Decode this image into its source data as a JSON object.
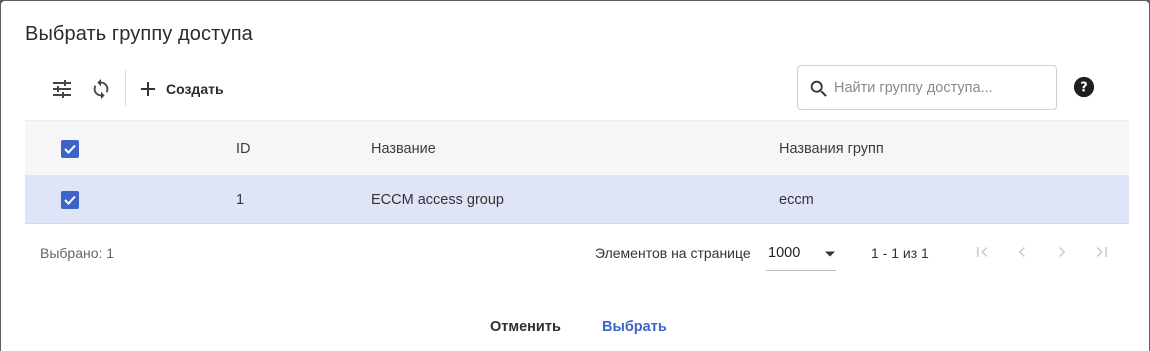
{
  "dialog": {
    "title": "Выбрать группу доступа"
  },
  "toolbar": {
    "filter_icon": "tune-icon",
    "refresh_icon": "refresh-icon",
    "create_label": "Создать",
    "search_placeholder": "Найти группу доступа..."
  },
  "table": {
    "columns": [
      "ID",
      "Название",
      "Названия групп"
    ],
    "rows": [
      {
        "selected": true,
        "id": "1",
        "name": "ECCM access group",
        "groups": "eccm"
      }
    ],
    "header_selected": true
  },
  "footer": {
    "selected_label": "Выбрано: 1",
    "per_page_label": "Элементов на странице",
    "per_page_value": "1000",
    "range_label": "1 - 1 из 1"
  },
  "actions": {
    "cancel_label": "Отменить",
    "select_label": "Выбрать"
  },
  "colors": {
    "accent": "#3d64c7",
    "selected_row": "#dfe4f6",
    "header_bg": "#f6f6f6"
  }
}
